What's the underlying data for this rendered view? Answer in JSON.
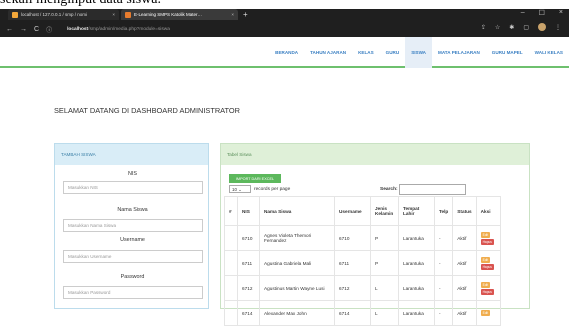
{
  "top_cut_text": "sekali menginput data siswa.",
  "browser": {
    "tabs": [
      {
        "title": "localhost / 127.0.0.1 / smp / nomi",
        "close": "×"
      },
      {
        "title": "E-Learning SMPS Katolik Mater…",
        "close": "×"
      }
    ],
    "new_tab": "+",
    "controls": {
      "minimize": "–",
      "maximize": "☐",
      "close": "×"
    },
    "back": "←",
    "forward": "→",
    "reload": "C",
    "info": "ⓘ",
    "url_host": "localhost",
    "url_path": "/smp/admin/media.php?module=siswa",
    "icons": {
      "share": "⇪",
      "star": "☆",
      "ext": "✱",
      "side": "▢",
      "menu": "⋮"
    }
  },
  "nav": {
    "items": [
      {
        "label": "BERANDA",
        "active": false
      },
      {
        "label": "TAHUN AJARAN",
        "active": false
      },
      {
        "label": "KELAS",
        "active": false
      },
      {
        "label": "GURU",
        "active": false
      },
      {
        "label": "SISWA",
        "active": true
      },
      {
        "label": "MATA PELAJARAN",
        "active": false
      },
      {
        "label": "GURU MAPEL",
        "active": false
      },
      {
        "label": "WALI KELAS",
        "active": false
      }
    ]
  },
  "welcome": "SELAMAT DATANG DI DASHBOARD ADMINISTRATOR",
  "form": {
    "title": "TAMBAH SISWA",
    "nis_label": "NIS",
    "nis_placeholder": "Masukkan NIS",
    "nama_label": "Nama Siswa",
    "nama_placeholder": "Masukkan Nama Siswa",
    "user_label": "Username",
    "user_placeholder": "Masukkan Username",
    "pass_label": "Password",
    "pass_placeholder": "Masukkan Password"
  },
  "table_panel": {
    "title": "Tabel Siswa",
    "import_label": "IMPORT DARI EXCEL",
    "length_value": "10",
    "length_suffix": "records per page",
    "search_label": "Search:",
    "headers": [
      "#",
      "NIS",
      "Nama Siswa",
      "Username",
      "Jenis Kelamin",
      "Tempat Lahir",
      "Telp",
      "Status",
      "Aksi"
    ],
    "edit_label": "Edit",
    "delete_label": "Hapus",
    "rows": [
      {
        "nis": "6710",
        "nama": "Agnes Violeta Themori Fernandez",
        "username": "6710",
        "jk": "P",
        "tempat": "Larantuka",
        "telp": "-",
        "status": "Aktif"
      },
      {
        "nis": "6711",
        "nama": "Agustina Gabriela Mali",
        "username": "6711",
        "jk": "P",
        "tempat": "Larantuka",
        "telp": "-",
        "status": "Aktif"
      },
      {
        "nis": "6712",
        "nama": "Agustinus Martin Wayne Lusi",
        "username": "6712",
        "jk": "L",
        "tempat": "Larantuka",
        "telp": "-",
        "status": "Aktif"
      },
      {
        "nis": "6714",
        "nama": "Alexander Max John",
        "username": "6714",
        "jk": "L",
        "tempat": "Larantuka",
        "telp": "-",
        "status": "Aktif"
      }
    ]
  }
}
